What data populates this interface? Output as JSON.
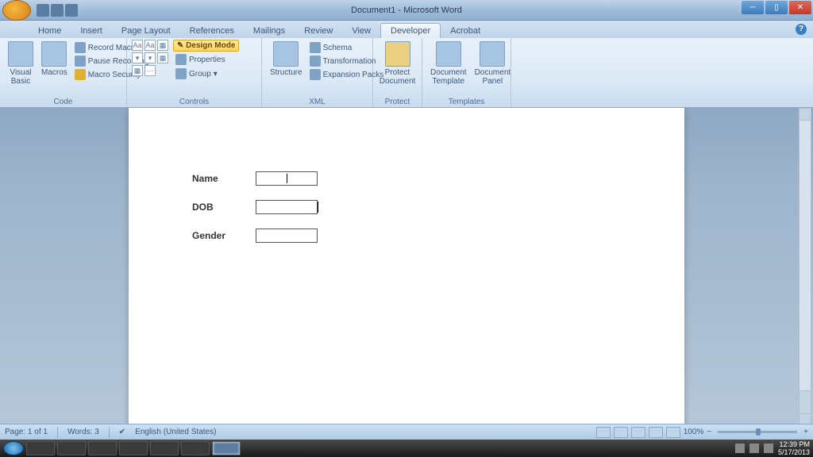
{
  "title": "Document1 - Microsoft Word",
  "tabs": [
    "Home",
    "Insert",
    "Page Layout",
    "References",
    "Mailings",
    "Review",
    "View",
    "Developer",
    "Acrobat"
  ],
  "activeTab": "Developer",
  "ribbon": {
    "code": {
      "label": "Code",
      "visual": "Visual\nBasic",
      "macros": "Macros",
      "record": "Record Macro",
      "pause": "Pause Recording",
      "security": "Macro Security"
    },
    "controls": {
      "label": "Controls",
      "design": "Design Mode",
      "properties": "Properties",
      "group": "Group"
    },
    "xml": {
      "label": "XML",
      "structure": "Structure",
      "schema": "Schema",
      "transform": "Transformation",
      "packs": "Expansion Packs"
    },
    "protect": {
      "label": "Protect",
      "btn": "Protect\nDocument"
    },
    "templates": {
      "label": "Templates",
      "tmpl": "Document\nTemplate",
      "panel": "Document\nPanel"
    }
  },
  "form": {
    "name": "Name",
    "dob": "DOB",
    "gender": "Gender"
  },
  "status": {
    "page": "Page: 1 of 1",
    "words": "Words: 3",
    "lang": "English (United States)",
    "zoom": "100%"
  },
  "taskbar": {
    "time": "12:39 PM",
    "date": "5/17/2013"
  }
}
